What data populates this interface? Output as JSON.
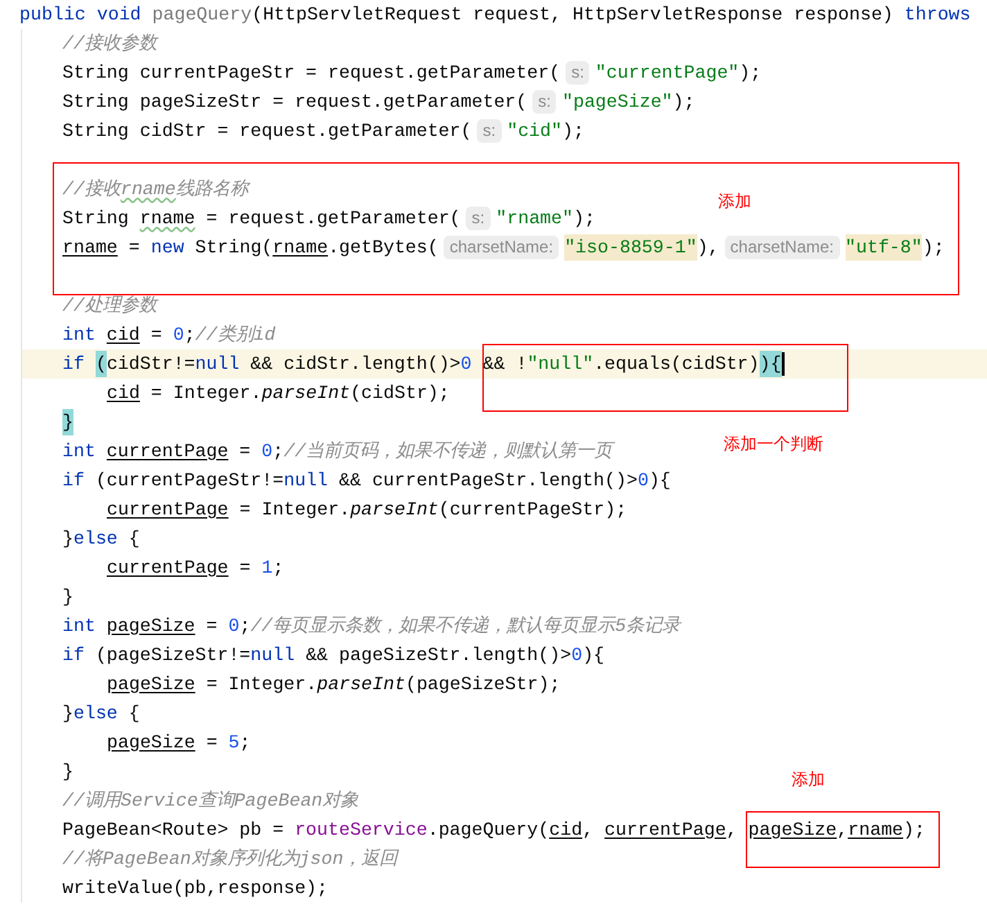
{
  "editor": {
    "lines": [
      {
        "kind": "code",
        "current": false,
        "tokens": [
          {
            "kind": "kw",
            "text": "public "
          },
          {
            "kind": "kw",
            "text": "void "
          },
          {
            "kind": "unused",
            "text": "pageQuery"
          },
          {
            "kind": "plain",
            "text": "(HttpServletRequest request, HttpServletResponse response) "
          },
          {
            "kind": "kw",
            "text": "throws"
          }
        ],
        "children": [
          {
            "kind": "code",
            "current": false,
            "tokens": [
              {
                "kind": "comment",
                "text": "//接收参数"
              }
            ]
          },
          {
            "kind": "code",
            "current": false,
            "tokens": [
              {
                "kind": "plain",
                "text": "String currentPageStr = request.getParameter("
              },
              {
                "kind": "hint",
                "text": "s:"
              },
              {
                "kind": "str",
                "text": "\"currentPage\""
              },
              {
                "kind": "plain",
                "text": ");"
              }
            ]
          },
          {
            "kind": "code",
            "current": false,
            "tokens": [
              {
                "kind": "plain",
                "text": "String pageSizeStr = request.getParameter("
              },
              {
                "kind": "hint",
                "text": "s:"
              },
              {
                "kind": "str",
                "text": "\"pageSize\""
              },
              {
                "kind": "plain",
                "text": ");"
              }
            ]
          },
          {
            "kind": "code",
            "current": false,
            "tokens": [
              {
                "kind": "plain",
                "text": "String cidStr = request.getParameter("
              },
              {
                "kind": "hint",
                "text": "s:"
              },
              {
                "kind": "str",
                "text": "\"cid\""
              },
              {
                "kind": "plain",
                "text": ");"
              }
            ]
          },
          {
            "kind": "blank",
            "current": false
          },
          {
            "kind": "code",
            "current": false,
            "tokens": [
              {
                "kind": "comment",
                "text": "//接收"
              },
              {
                "kind": "comment_typo",
                "text": "rname"
              },
              {
                "kind": "comment",
                "text": "线路名称"
              }
            ]
          },
          {
            "kind": "code",
            "current": false,
            "tokens": [
              {
                "kind": "plain",
                "text": "String "
              },
              {
                "kind": "typo",
                "text": "rname"
              },
              {
                "kind": "plain",
                "text": " = request.getParameter("
              },
              {
                "kind": "hint",
                "text": "s:"
              },
              {
                "kind": "str",
                "text": "\"rname\""
              },
              {
                "kind": "plain",
                "text": ");"
              }
            ]
          },
          {
            "kind": "code",
            "current": false,
            "tokens": [
              {
                "kind": "field",
                "text": "rname"
              },
              {
                "kind": "plain",
                "text": " = "
              },
              {
                "kind": "kw",
                "text": "new"
              },
              {
                "kind": "plain",
                "text": " String("
              },
              {
                "kind": "field",
                "text": "rname"
              },
              {
                "kind": "plain",
                "text": ".getBytes("
              },
              {
                "kind": "hint",
                "text": "charsetName:"
              },
              {
                "kind": "strhl",
                "text": "\"iso-8859-1\""
              },
              {
                "kind": "plain",
                "text": "),"
              },
              {
                "kind": "hint",
                "text": "charsetName:"
              },
              {
                "kind": "strhl",
                "text": "\"utf-8\""
              },
              {
                "kind": "plain",
                "text": ");"
              }
            ]
          },
          {
            "kind": "blank",
            "current": false
          },
          {
            "kind": "code",
            "current": false,
            "tokens": [
              {
                "kind": "comment",
                "text": "//处理参数"
              }
            ]
          },
          {
            "kind": "code",
            "current": false,
            "tokens": [
              {
                "kind": "kw",
                "text": "int "
              },
              {
                "kind": "field",
                "text": "cid"
              },
              {
                "kind": "plain",
                "text": " = "
              },
              {
                "kind": "num",
                "text": "0"
              },
              {
                "kind": "plain",
                "text": ";"
              },
              {
                "kind": "comment",
                "text": "//类别id"
              }
            ]
          },
          {
            "kind": "code",
            "current": true,
            "tokens": [
              {
                "kind": "kw",
                "text": "if "
              },
              {
                "kind": "match",
                "text": "("
              },
              {
                "kind": "plain",
                "text": "cidStr!="
              },
              {
                "kind": "kw",
                "text": "null"
              },
              {
                "kind": "plain",
                "text": " && cidStr.length()>"
              },
              {
                "kind": "num",
                "text": "0"
              },
              {
                "kind": "plain",
                "text": " && !"
              },
              {
                "kind": "str",
                "text": "\"null\""
              },
              {
                "kind": "plain",
                "text": ".equals(cidStr)"
              },
              {
                "kind": "match",
                "text": ")"
              },
              {
                "kind": "match",
                "text": "{"
              }
            ],
            "children": [
              {
                "kind": "code",
                "current": false,
                "tokens": [
                  {
                    "kind": "field",
                    "text": "cid"
                  },
                  {
                    "kind": "plain",
                    "text": " = Integer."
                  },
                  {
                    "kind": "italic",
                    "text": "parseInt"
                  },
                  {
                    "kind": "plain",
                    "text": "(cidStr);"
                  }
                ]
              }
            ]
          },
          {
            "kind": "code",
            "current": false,
            "tokens": [
              {
                "kind": "match",
                "text": "}"
              }
            ]
          },
          {
            "kind": "code",
            "current": false,
            "tokens": [
              {
                "kind": "kw",
                "text": "int "
              },
              {
                "kind": "field",
                "text": "currentPage"
              },
              {
                "kind": "plain",
                "text": " = "
              },
              {
                "kind": "num",
                "text": "0"
              },
              {
                "kind": "plain",
                "text": ";"
              },
              {
                "kind": "comment",
                "text": "//当前页码，如果不传递，则默认第一页"
              }
            ]
          },
          {
            "kind": "code",
            "current": false,
            "tokens": [
              {
                "kind": "kw",
                "text": "if"
              },
              {
                "kind": "plain",
                "text": " (currentPageStr!="
              },
              {
                "kind": "kw",
                "text": "null"
              },
              {
                "kind": "plain",
                "text": " && currentPageStr.length()>"
              },
              {
                "kind": "num",
                "text": "0"
              },
              {
                "kind": "plain",
                "text": "){"
              }
            ],
            "children": [
              {
                "kind": "code",
                "current": false,
                "tokens": [
                  {
                    "kind": "field",
                    "text": "currentPage"
                  },
                  {
                    "kind": "plain",
                    "text": " = Integer."
                  },
                  {
                    "kind": "italic",
                    "text": "parseInt"
                  },
                  {
                    "kind": "plain",
                    "text": "(currentPageStr);"
                  }
                ]
              }
            ]
          },
          {
            "kind": "code",
            "current": false,
            "tokens": [
              {
                "kind": "plain",
                "text": "}"
              },
              {
                "kind": "kw",
                "text": "else"
              },
              {
                "kind": "plain",
                "text": " {"
              }
            ],
            "children": [
              {
                "kind": "code",
                "current": false,
                "tokens": [
                  {
                    "kind": "field",
                    "text": "currentPage"
                  },
                  {
                    "kind": "plain",
                    "text": " = "
                  },
                  {
                    "kind": "num",
                    "text": "1"
                  },
                  {
                    "kind": "plain",
                    "text": ";"
                  }
                ]
              }
            ]
          },
          {
            "kind": "code",
            "current": false,
            "tokens": [
              {
                "kind": "plain",
                "text": "}"
              }
            ]
          },
          {
            "kind": "code",
            "current": false,
            "tokens": [
              {
                "kind": "kw",
                "text": "int "
              },
              {
                "kind": "field",
                "text": "pageSize"
              },
              {
                "kind": "plain",
                "text": " = "
              },
              {
                "kind": "num",
                "text": "0"
              },
              {
                "kind": "plain",
                "text": ";"
              },
              {
                "kind": "comment",
                "text": "//每页显示条数，如果不传递，默认每页显示5条记录"
              }
            ]
          },
          {
            "kind": "code",
            "current": false,
            "tokens": [
              {
                "kind": "kw",
                "text": "if"
              },
              {
                "kind": "plain",
                "text": " (pageSizeStr!="
              },
              {
                "kind": "kw",
                "text": "null"
              },
              {
                "kind": "plain",
                "text": " && pageSizeStr.length()>"
              },
              {
                "kind": "num",
                "text": "0"
              },
              {
                "kind": "plain",
                "text": "){"
              }
            ],
            "children": [
              {
                "kind": "code",
                "current": false,
                "tokens": [
                  {
                    "kind": "field",
                    "text": "pageSize"
                  },
                  {
                    "kind": "plain",
                    "text": " = Integer."
                  },
                  {
                    "kind": "italic",
                    "text": "parseInt"
                  },
                  {
                    "kind": "plain",
                    "text": "(pageSizeStr);"
                  }
                ]
              }
            ]
          },
          {
            "kind": "code",
            "current": false,
            "tokens": [
              {
                "kind": "plain",
                "text": "}"
              },
              {
                "kind": "kw",
                "text": "else"
              },
              {
                "kind": "plain",
                "text": " {"
              }
            ],
            "children": [
              {
                "kind": "code",
                "current": false,
                "tokens": [
                  {
                    "kind": "field",
                    "text": "pageSize"
                  },
                  {
                    "kind": "plain",
                    "text": " = "
                  },
                  {
                    "kind": "num",
                    "text": "5"
                  },
                  {
                    "kind": "plain",
                    "text": ";"
                  }
                ]
              }
            ]
          },
          {
            "kind": "code",
            "current": false,
            "tokens": [
              {
                "kind": "plain",
                "text": "}"
              }
            ]
          },
          {
            "kind": "code",
            "current": false,
            "tokens": [
              {
                "kind": "comment",
                "text": "//调用Service查询PageBean对象"
              }
            ]
          },
          {
            "kind": "code",
            "current": false,
            "tokens": [
              {
                "kind": "plain",
                "text": "PageBean<Route> pb = "
              },
              {
                "kind": "purple",
                "text": "routeService"
              },
              {
                "kind": "plain",
                "text": ".pageQuery("
              },
              {
                "kind": "field",
                "text": "cid"
              },
              {
                "kind": "plain",
                "text": ", "
              },
              {
                "kind": "field",
                "text": "currentPage"
              },
              {
                "kind": "plain",
                "text": ", "
              },
              {
                "kind": "field",
                "text": "pageSize"
              },
              {
                "kind": "plain",
                "text": ","
              },
              {
                "kind": "field",
                "text": "rname"
              },
              {
                "kind": "plain",
                "text": ");"
              }
            ]
          },
          {
            "kind": "code",
            "current": false,
            "tokens": [
              {
                "kind": "comment",
                "text": "//将PageBean对象序列化为json，返回"
              }
            ]
          },
          {
            "kind": "code",
            "current": false,
            "tokens": [
              {
                "kind": "plain",
                "text": "writeValue(pb,response);"
              }
            ]
          }
        ]
      }
    ]
  },
  "annotations": [
    {
      "label": "添加"
    },
    {
      "label": "添加一个判断"
    },
    {
      "label": "添加"
    }
  ]
}
